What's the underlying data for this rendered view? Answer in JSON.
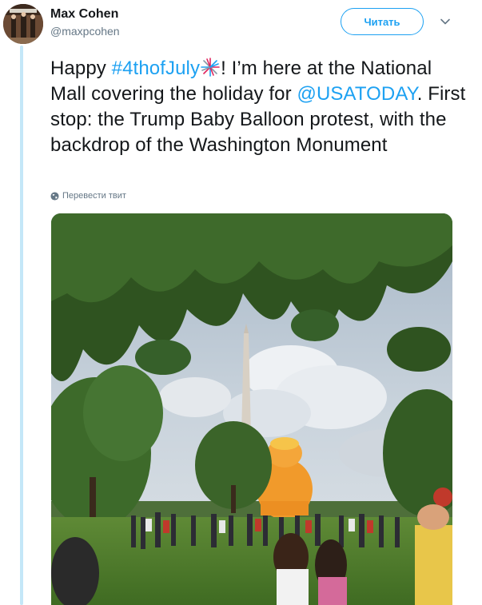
{
  "author": {
    "name": "Max Cohen",
    "handle": "@maxpcohen"
  },
  "follow_button": {
    "label": "Читать"
  },
  "tweet": {
    "text_1": "Happy ",
    "hashtag": "#4thofJuly",
    "text_2": "! I’m here at the National Mall covering the holiday for ",
    "mention": "@USATODAY",
    "text_3": ". First stop: the Trump Baby Balloon protest, with the backdrop of the Washington Monument",
    "emoji": "fireworks-icon"
  },
  "translate_link": {
    "label": "Перевести твит"
  },
  "colors": {
    "accent": "#1da1f2",
    "thread_line": "#c4e7f8",
    "secondary_text": "#657786"
  }
}
